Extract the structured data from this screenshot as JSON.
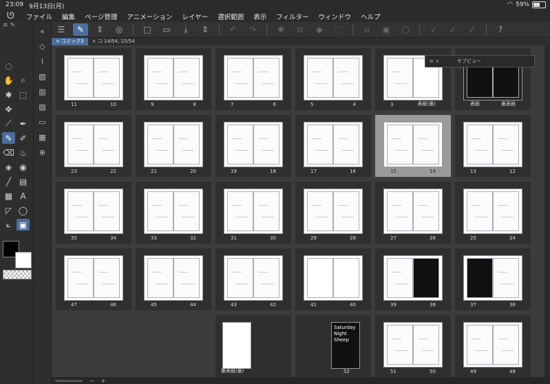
{
  "status": {
    "time": "23:09",
    "date": "9月13日(月)",
    "battery": "59%",
    "battery_level": 0.59
  },
  "menu": {
    "items": [
      "ファイル",
      "編集",
      "ページ管理",
      "アニメーション",
      "レイヤー",
      "選択範囲",
      "表示",
      "フィルター",
      "ウィンドウ",
      "ヘルプ"
    ]
  },
  "tabs": [
    {
      "label": "コミック3",
      "close": "×"
    },
    {
      "label": "コ 14/54, 15/54",
      "close": "×"
    }
  ],
  "subview": {
    "title": "サブビュー"
  },
  "bottom": {
    "minus": "−",
    "plus": "+"
  },
  "pages": [
    {
      "left": "11",
      "right": "10"
    },
    {
      "left": "9",
      "right": "8"
    },
    {
      "left": "7",
      "right": "6"
    },
    {
      "left": "5",
      "right": "4"
    },
    {
      "left": "3",
      "right": "表紙(裏)"
    },
    {
      "left": "表紙",
      "right": "裏表紙"
    },
    {
      "left": "23",
      "right": "22"
    },
    {
      "left": "21",
      "right": "20"
    },
    {
      "left": "19",
      "right": "18"
    },
    {
      "left": "17",
      "right": "16"
    },
    {
      "left": "15",
      "right": "14",
      "selected": true
    },
    {
      "left": "13",
      "right": "12"
    },
    {
      "left": "35",
      "right": "34"
    },
    {
      "left": "33",
      "right": "32"
    },
    {
      "left": "31",
      "right": "30"
    },
    {
      "left": "29",
      "right": "28"
    },
    {
      "left": "27",
      "right": "26"
    },
    {
      "left": "25",
      "right": "24"
    },
    {
      "left": "47",
      "right": "46"
    },
    {
      "left": "45",
      "right": "44"
    },
    {
      "left": "43",
      "right": "42"
    },
    {
      "left": "41",
      "right": "40"
    },
    {
      "left": "39",
      "right": "38"
    },
    {
      "left": "37",
      "right": "36"
    },
    {
      "left": "",
      "right": ""
    },
    {
      "left": "",
      "right": ""
    },
    {
      "left": "",
      "right": "裏表紙(裏)"
    },
    {
      "left": "",
      "right": "52",
      "cover_text": "Saturday Night Sheep"
    },
    {
      "left": "51",
      "right": "50"
    },
    {
      "left": "49",
      "right": "48"
    }
  ]
}
